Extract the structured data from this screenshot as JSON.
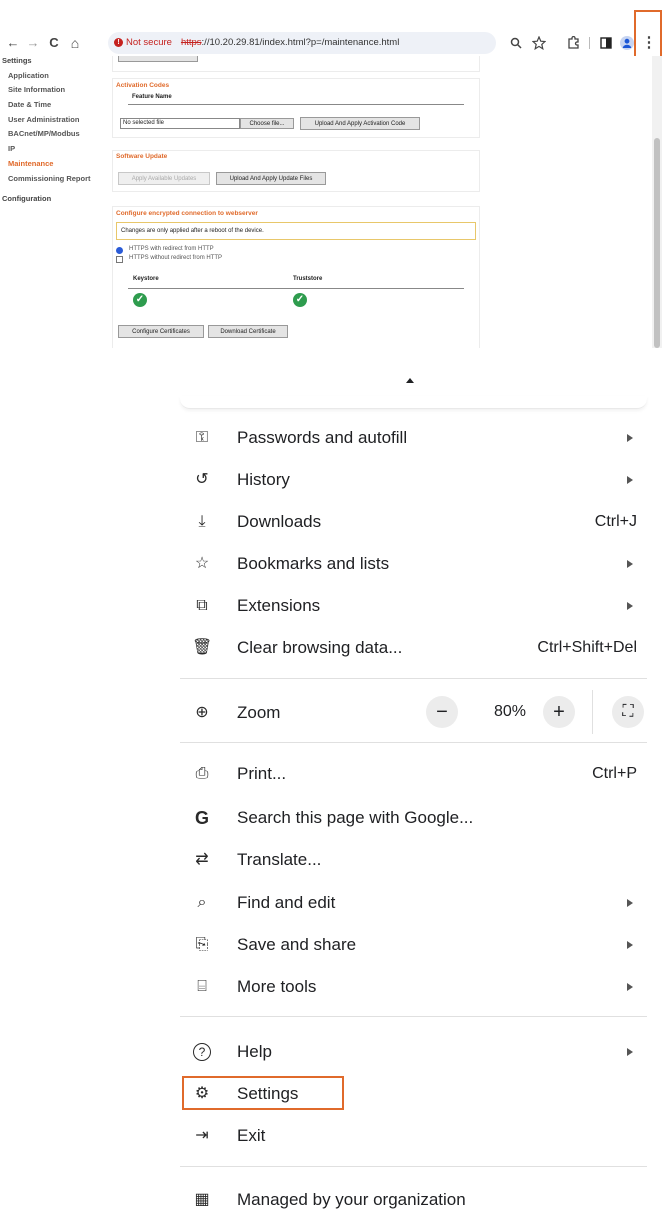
{
  "browser": {
    "nav": {
      "back": "←",
      "forward": "→",
      "reload": "C",
      "home": "⌂"
    },
    "security_label": "Not secure",
    "url_scheme": "https",
    "url_rest": "://10.20.29.81/index.html?p=/maintenance.html",
    "menu_button": "⋮"
  },
  "sidebar": {
    "items": [
      {
        "label": "Settings"
      },
      {
        "label": "Application"
      },
      {
        "label": "Site Information"
      },
      {
        "label": "Date & Time"
      },
      {
        "label": "User Administration"
      },
      {
        "label": "BACnet/MP/Modbus"
      },
      {
        "label": "IP"
      },
      {
        "label": "Maintenance"
      },
      {
        "label": "Commissioning Report"
      },
      {
        "label": "Configuration"
      }
    ],
    "active_color": "#e06a2b"
  },
  "activation": {
    "title": "Activation Codes",
    "column": "Feature Name",
    "file_value": "No selected file",
    "choose_label": "Choose file...",
    "upload_label": "Upload And Apply Activation Code"
  },
  "software": {
    "title": "Software Update",
    "apply_label": "Apply Available Updates",
    "upload_label": "Upload And Apply Update Files"
  },
  "encrypt": {
    "title": "Configure encrypted connection to webserver",
    "notice": "Changes are only applied after a reboot of the device.",
    "option1": "HTTPS with redirect from HTTP",
    "option2": "HTTPS without redirect from HTTP",
    "col1": "Keystore",
    "col2": "Truststore",
    "check": "✓",
    "configure_label": "Configure Certificates",
    "download_label": "Download Certificate"
  },
  "menu": {
    "passwords": {
      "label": "Passwords and autofill",
      "icon": "key-icon",
      "glyph": "⚿"
    },
    "history": {
      "label": "History",
      "icon": "history-icon",
      "glyph": "↺"
    },
    "downloads": {
      "label": "Downloads",
      "shortcut": "Ctrl+J",
      "icon": "download-icon",
      "glyph": "⤓"
    },
    "bookmarks": {
      "label": "Bookmarks and lists",
      "icon": "star-icon",
      "glyph": "☆"
    },
    "extensions": {
      "label": "Extensions",
      "icon": "puzzle-icon",
      "glyph": "⧉"
    },
    "clear": {
      "label": "Clear browsing data...",
      "shortcut": "Ctrl+Shift+Del",
      "icon": "trash-icon",
      "glyph": "🗑"
    },
    "zoom": {
      "label": "Zoom",
      "value": "80%",
      "minus": "−",
      "plus": "+",
      "fullscreen": "⛶",
      "icon": "zoom-icon",
      "glyph": "⊕"
    },
    "print": {
      "label": "Print...",
      "shortcut": "Ctrl+P",
      "icon": "printer-icon",
      "glyph": "⎙"
    },
    "search": {
      "label": "Search this page with Google...",
      "icon": "google-icon",
      "glyph": "G"
    },
    "translate": {
      "label": "Translate...",
      "icon": "translate-icon",
      "glyph": "⇄"
    },
    "find": {
      "label": "Find and edit",
      "icon": "find-icon",
      "glyph": "⌕"
    },
    "save": {
      "label": "Save and share",
      "icon": "save-icon",
      "glyph": "⎘"
    },
    "tools": {
      "label": "More tools",
      "icon": "toolbox-icon",
      "glyph": "⌸"
    },
    "help": {
      "label": "Help",
      "icon": "help-icon",
      "glyph": "?"
    },
    "settings": {
      "label": "Settings",
      "icon": "gear-icon",
      "glyph": "⚙"
    },
    "exit": {
      "label": "Exit",
      "icon": "exit-icon",
      "glyph": "⇥"
    },
    "managed": {
      "label": "Managed by your organization",
      "icon": "building-icon",
      "glyph": "▦"
    }
  },
  "colors": {
    "highlight": "#e06a2b",
    "ok": "#2e9c4e"
  }
}
